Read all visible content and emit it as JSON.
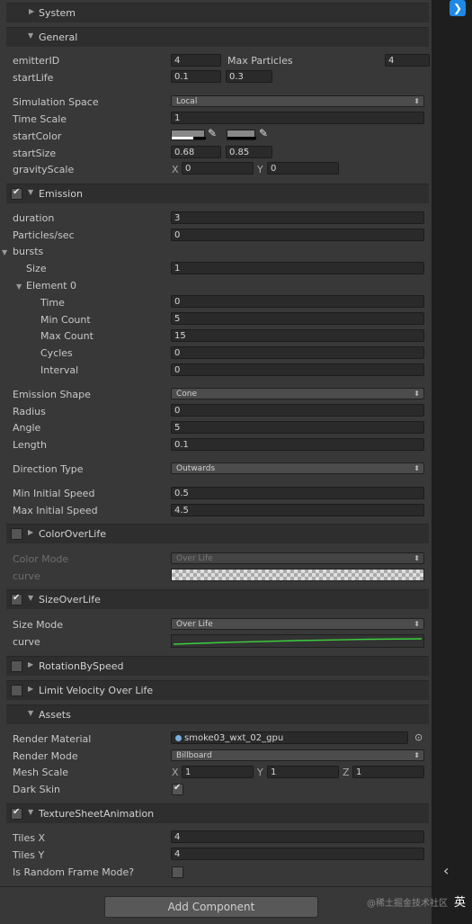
{
  "sections": {
    "system": "System",
    "general": "General",
    "emission": "Emission",
    "color_over_life": "ColorOverLife",
    "size_over_life": "SizeOverLife",
    "rotation_by_speed": "RotationBySpeed",
    "limit_velocity": "Limit Velocity Over Life",
    "assets": "Assets",
    "texture_sheet": "TextureSheetAnimation"
  },
  "general": {
    "emitter_id_label": "emitterID",
    "emitter_id": "4",
    "max_particles_label": "Max Particles",
    "max_particles": "4",
    "start_life_label": "startLife",
    "start_life_min": "0.1",
    "start_life_max": "0.3",
    "sim_space_label": "Simulation Space",
    "sim_space": "Local",
    "time_scale_label": "Time Scale",
    "time_scale": "1",
    "start_color_label": "startColor",
    "start_size_label": "startSize",
    "start_size_min": "0.68",
    "start_size_max": "0.85",
    "gravity_label": "gravityScale",
    "gravity_x": "0",
    "gravity_y": "0",
    "x_label": "X",
    "y_label": "Y"
  },
  "emission": {
    "duration_label": "duration",
    "duration": "3",
    "pps_label": "Particles/sec",
    "pps": "0",
    "bursts_label": "bursts",
    "size_label": "Size",
    "size": "1",
    "element_label": "Element 0",
    "time_label": "Time",
    "time": "0",
    "min_count_label": "Min Count",
    "min_count": "5",
    "max_count_label": "Max Count",
    "max_count": "15",
    "cycles_label": "Cycles",
    "cycles": "0",
    "interval_label": "Interval",
    "interval": "0",
    "shape_label": "Emission Shape",
    "shape": "Cone",
    "radius_label": "Radius",
    "radius": "0",
    "angle_label": "Angle",
    "angle": "5",
    "length_label": "Length",
    "length": "0.1",
    "direction_label": "Direction Type",
    "direction": "Outwards",
    "min_speed_label": "Min Initial Speed",
    "min_speed": "0.5",
    "max_speed_label": "Max Initial Speed",
    "max_speed": "4.5"
  },
  "color_over_life": {
    "mode_label": "Color Mode",
    "mode": "Over Life",
    "curve_label": "curve"
  },
  "size_over_life": {
    "mode_label": "Size Mode",
    "mode": "Over Life",
    "curve_label": "curve"
  },
  "assets": {
    "material_label": "Render Material",
    "material": "smoke03_wxt_02_gpu",
    "render_mode_label": "Render Mode",
    "render_mode": "Billboard",
    "mesh_scale_label": "Mesh Scale",
    "mesh_x": "1",
    "mesh_y": "1",
    "mesh_z": "1",
    "z_label": "Z",
    "dark_skin_label": "Dark Skin"
  },
  "texture_sheet": {
    "tiles_x_label": "Tiles X",
    "tiles_x": "4",
    "tiles_y_label": "Tiles Y",
    "tiles_y": "4",
    "random_label": "Is Random Frame Mode?"
  },
  "add_component": "Add Component",
  "watermark": "@稀土掘金技术社区",
  "ime": "英",
  "colors": {
    "panel": "#383838",
    "header": "#2e2e2e",
    "field": "#2a2a2a",
    "accent_blue": "#1e88e5",
    "curve_green": "#3cd03c"
  }
}
